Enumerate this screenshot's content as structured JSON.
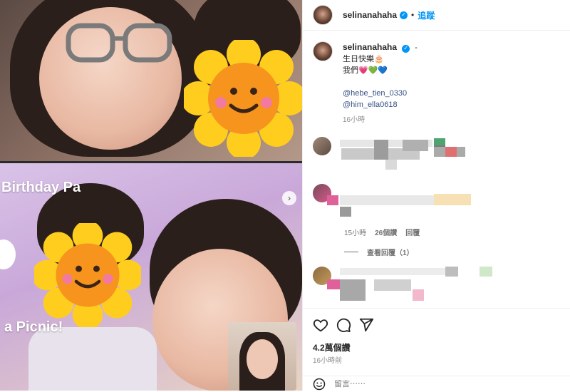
{
  "post": {
    "username": "selinanahaha",
    "follow_label": "追蹤",
    "separator": "•",
    "more_label": "-"
  },
  "caption": {
    "line1": "生日快樂🎂",
    "line2": "我們💗💚💙",
    "mention1": "@hebe_tien_0330",
    "mention2": "@him_ella0618",
    "time": "16小時"
  },
  "photo": {
    "banner_top": "Birthday Pa",
    "banner_bottom": "a Picnic!",
    "next_label": "›"
  },
  "comments": [
    {
      "time": "15小時",
      "likes": "26個讚",
      "reply_label": "回覆"
    }
  ],
  "view_replies": "查看回覆（1）",
  "footer": {
    "likes": "4.2萬個讚",
    "time": "16小時前",
    "comment_placeholder": "留言⋯⋯"
  },
  "colors": {
    "accent": "#0095f6",
    "mention": "#385185",
    "muted": "#8e8e8e"
  },
  "icons": [
    "heart-icon",
    "comment-icon",
    "share-icon",
    "emoji-icon",
    "verified-icon",
    "next-arrow-icon"
  ]
}
